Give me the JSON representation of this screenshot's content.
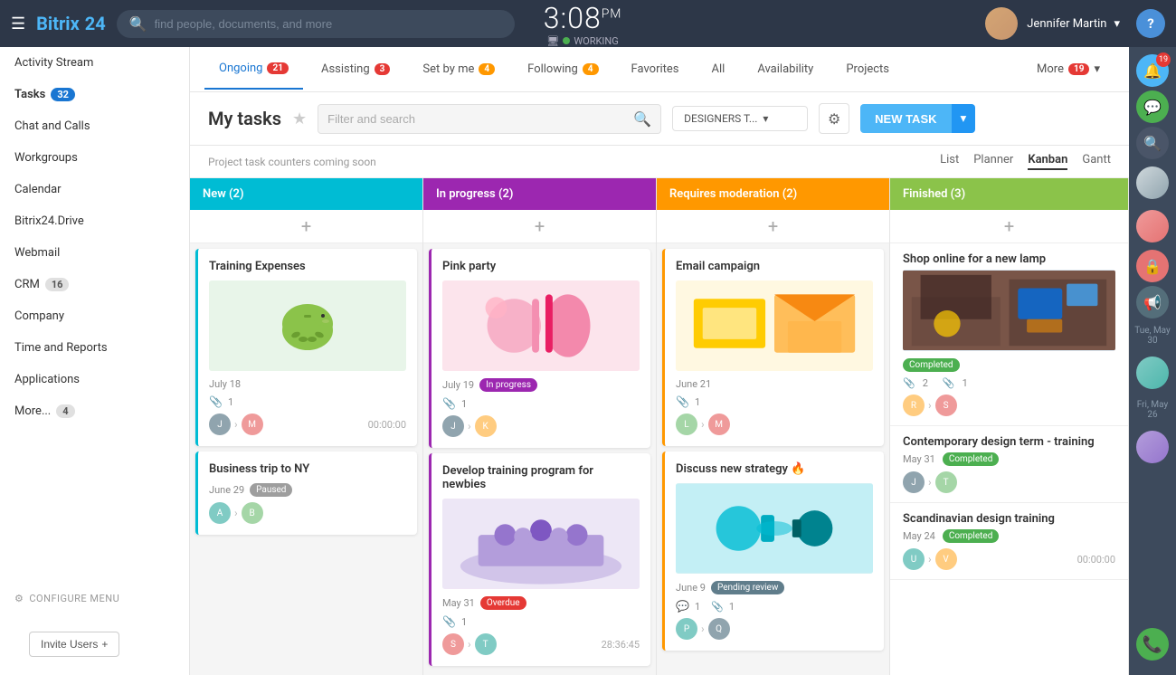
{
  "header": {
    "logo": "Bitrix",
    "logo_num": "24",
    "search_placeholder": "find people, documents, and more",
    "time": "3:08",
    "ampm": "PM",
    "monitor_icon": "1",
    "status": "WORKING",
    "user_name": "Jennifer Martin",
    "help_label": "?"
  },
  "sidebar": {
    "items": [
      {
        "label": "Activity Stream",
        "badge": null
      },
      {
        "label": "Tasks",
        "badge": "32",
        "badge_type": "blue"
      },
      {
        "label": "Chat and Calls",
        "badge": null
      },
      {
        "label": "Workgroups",
        "badge": null
      },
      {
        "label": "Calendar",
        "badge": null
      },
      {
        "label": "Bitrix24.Drive",
        "badge": null
      },
      {
        "label": "Webmail",
        "badge": null
      },
      {
        "label": "CRM",
        "badge": "16",
        "badge_type": "normal"
      },
      {
        "label": "Company",
        "badge": null
      },
      {
        "label": "Time and Reports",
        "badge": null
      },
      {
        "label": "Applications",
        "badge": null
      },
      {
        "label": "More...",
        "badge": "4",
        "badge_type": "normal"
      }
    ],
    "configure_label": "Configure Menu",
    "invite_label": "Invite Users",
    "invite_icon": "+"
  },
  "tabs": [
    {
      "label": "Ongoing",
      "badge": "21",
      "active": true
    },
    {
      "label": "Assisting",
      "badge": "3"
    },
    {
      "label": "Set by me",
      "badge": "4"
    },
    {
      "label": "Following",
      "badge": "4"
    },
    {
      "label": "Favorites",
      "badge": null
    },
    {
      "label": "All",
      "badge": null
    },
    {
      "label": "Availability",
      "badge": null
    },
    {
      "label": "Projects",
      "badge": null
    },
    {
      "label": "More",
      "badge": "19"
    }
  ],
  "task_header": {
    "title": "My tasks",
    "filter_placeholder": "Filter and search",
    "group_label": "DESIGNERS T...",
    "new_task_label": "NEW TASK"
  },
  "kanban": {
    "coming_soon": "Project task counters coming soon",
    "views": [
      "List",
      "Planner",
      "Kanban",
      "Gantt"
    ],
    "active_view": "Kanban",
    "columns": [
      {
        "label": "New",
        "count": 2,
        "color": "new",
        "cards": [
          {
            "title": "Training Expenses",
            "image": "piggy",
            "date": "July 18",
            "badge": null,
            "meta_count": "1",
            "avatars": [
              "a1",
              "a2"
            ],
            "time": "00:00:00",
            "border": "new-border"
          },
          {
            "title": "Business trip to NY",
            "image": null,
            "date": "June 29",
            "badge": "Paused",
            "badge_type": "paused",
            "meta_count": null,
            "avatars": [
              "a3",
              "a4"
            ],
            "time": null,
            "border": "new-border"
          }
        ]
      },
      {
        "label": "In progress",
        "count": 2,
        "color": "inprogress",
        "cards": [
          {
            "title": "Pink party",
            "image": "pink",
            "date": "July 19",
            "badge": "In progress",
            "badge_type": "inprogress",
            "meta_count": "1",
            "avatars": [
              "a1",
              "a5"
            ],
            "time": null,
            "border": "inprogress-border"
          },
          {
            "title": "Develop training program for newbies",
            "image": "meeting",
            "date": "May 31",
            "badge": "Overdue",
            "badge_type": "overdue",
            "meta_count": "1",
            "avatars": [
              "a2",
              "a3"
            ],
            "time": "28:36:45",
            "border": "inprogress-border"
          }
        ]
      },
      {
        "label": "Requires moderation",
        "count": 2,
        "color": "moderation",
        "cards": [
          {
            "title": "Email campaign",
            "image": "envelope",
            "date": "June 21",
            "badge": null,
            "meta_count": "1",
            "avatars": [
              "a4",
              "a2"
            ],
            "time": null,
            "border": "moderation-border"
          },
          {
            "title": "Discuss new strategy 🔥",
            "image": "shout",
            "date": "June 9",
            "badge": "Pending review",
            "badge_type": "pending",
            "meta_count_left": "1",
            "meta_count_right": "1",
            "avatars": [
              "a3",
              "a1"
            ],
            "time": null,
            "border": "moderation-border"
          }
        ]
      },
      {
        "label": "Finished",
        "count": 3,
        "color": "finished",
        "cards": [
          {
            "title": "Shop online for a new lamp",
            "image": "laptop",
            "date": null,
            "badge": "Completed",
            "badge_type": "completed",
            "meta_left": "2",
            "meta_right": "1",
            "avatars": [
              "a5",
              "a2"
            ],
            "time": null,
            "border": "finished-border"
          },
          {
            "title": "Contemporary design term - training",
            "date": "May 31",
            "badge": "Completed",
            "badge_type": "completed",
            "avatars": [
              "a1",
              "a4"
            ],
            "time": null
          },
          {
            "title": "Scandinavian design training",
            "date": "May 24",
            "badge": "Completed",
            "badge_type": "completed",
            "avatars": [
              "a3",
              "a5"
            ],
            "time": "00:00:00"
          }
        ]
      }
    ]
  },
  "right_panel": {
    "date1": "Tue, May 30",
    "date2": "Fri, May 26"
  }
}
